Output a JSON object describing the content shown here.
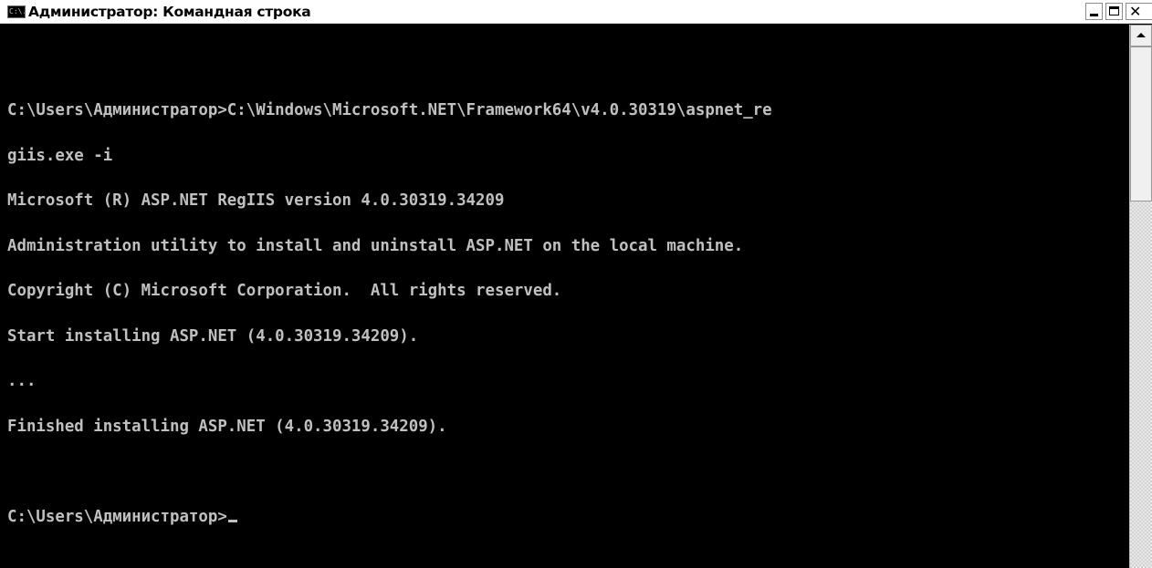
{
  "window": {
    "title": "Администратор: Командная строка",
    "icon": "cmd-icon",
    "icon_text": "C:\\.",
    "controls": {
      "minimize": "minimize-icon",
      "maximize": "maximize-icon",
      "close": "close-icon",
      "close_glyph": "✕"
    }
  },
  "console": {
    "text_color": "#c0c0c0",
    "background": "#000000",
    "lines": [
      "C:\\Users\\Администратор>C:\\Windows\\Microsoft.NET\\Framework64\\v4.0.30319\\aspnet_re",
      "giis.exe -i",
      "Microsoft (R) ASP.NET RegIIS version 4.0.30319.34209",
      "Administration utility to install and uninstall ASP.NET on the local machine.",
      "Copyright (C) Microsoft Corporation.  All rights reserved.",
      "Start installing ASP.NET (4.0.30319.34209).",
      "...",
      "Finished installing ASP.NET (4.0.30319.34209).",
      "",
      "C:\\Users\\Администратор>"
    ]
  },
  "scrollbar": {
    "up_arrow": "chevron-up-icon"
  }
}
